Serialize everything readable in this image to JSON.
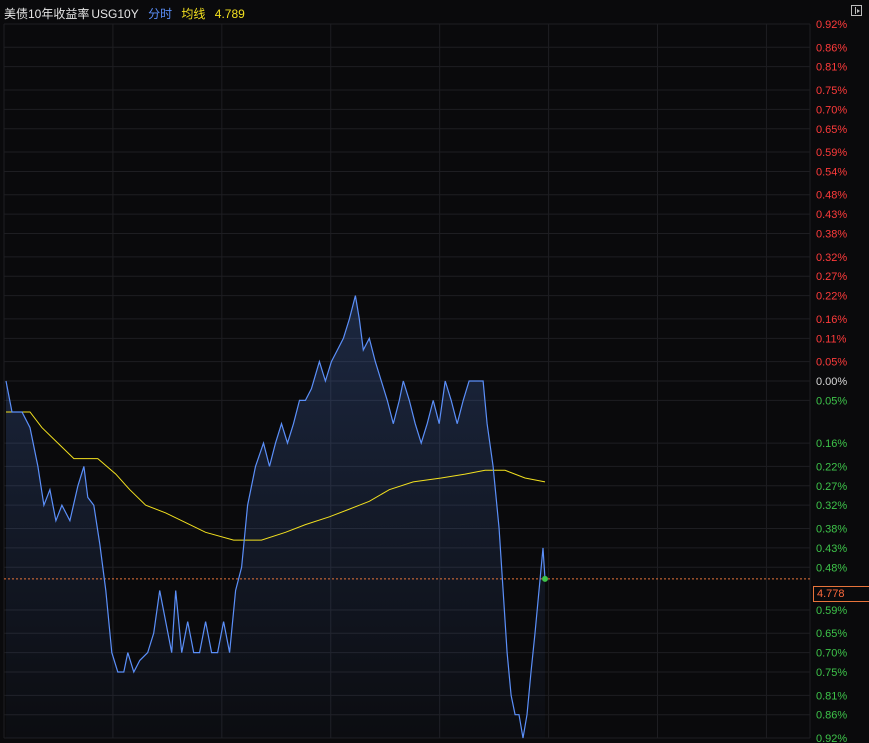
{
  "header": {
    "name": "美债10年收益率",
    "code": "USG10Y",
    "mode_label": "分时",
    "avg_label": "均线",
    "avg_value": "4.789"
  },
  "colors": {
    "background": "#0a0a0c",
    "grid": "#1e1e22",
    "price_line": "#5b8ff9",
    "avg_line": "#f2e01f",
    "up": "#ff3b3b",
    "down": "#3ec44a",
    "zero": "#d8d8d8",
    "reference": "#e8743b"
  },
  "chart_data": {
    "type": "line",
    "title": "",
    "xlabel": "",
    "ylabel": "",
    "grid": true,
    "ylim": [
      -0.92,
      0.92
    ],
    "current_value": "4.778",
    "current_change_pct": -0.51,
    "y_ticks": [
      {
        "label": "0.92%",
        "value": 0.92
      },
      {
        "label": "0.86%",
        "value": 0.86
      },
      {
        "label": "0.81%",
        "value": 0.81
      },
      {
        "label": "0.75%",
        "value": 0.75
      },
      {
        "label": "0.70%",
        "value": 0.7
      },
      {
        "label": "0.65%",
        "value": 0.65
      },
      {
        "label": "0.59%",
        "value": 0.59
      },
      {
        "label": "0.54%",
        "value": 0.54
      },
      {
        "label": "0.48%",
        "value": 0.48
      },
      {
        "label": "0.43%",
        "value": 0.43
      },
      {
        "label": "0.38%",
        "value": 0.38
      },
      {
        "label": "0.32%",
        "value": 0.32
      },
      {
        "label": "0.27%",
        "value": 0.27
      },
      {
        "label": "0.22%",
        "value": 0.22
      },
      {
        "label": "0.16%",
        "value": 0.16
      },
      {
        "label": "0.11%",
        "value": 0.11
      },
      {
        "label": "0.05%",
        "value": 0.05
      },
      {
        "label": "0.00%",
        "value": 0.0
      },
      {
        "label": "0.05%",
        "value": -0.05
      },
      {
        "label": "0.16%",
        "value": -0.16
      },
      {
        "label": "0.22%",
        "value": -0.22
      },
      {
        "label": "0.27%",
        "value": -0.27
      },
      {
        "label": "0.32%",
        "value": -0.32
      },
      {
        "label": "0.38%",
        "value": -0.38
      },
      {
        "label": "0.43%",
        "value": -0.43
      },
      {
        "label": "0.48%",
        "value": -0.48
      },
      {
        "label": "0.59%",
        "value": -0.59
      },
      {
        "label": "0.65%",
        "value": -0.65
      },
      {
        "label": "0.70%",
        "value": -0.7
      },
      {
        "label": "0.75%",
        "value": -0.75
      },
      {
        "label": "0.81%",
        "value": -0.81
      },
      {
        "label": "0.86%",
        "value": -0.86
      },
      {
        "label": "0.92%",
        "value": -0.92
      }
    ],
    "x_max": 270,
    "series": [
      {
        "key": "price",
        "points": [
          [
            0,
            0.0
          ],
          [
            3,
            -0.08
          ],
          [
            8,
            -0.08
          ],
          [
            12,
            -0.12
          ],
          [
            16,
            -0.22
          ],
          [
            19,
            -0.32
          ],
          [
            22,
            -0.28
          ],
          [
            25,
            -0.36
          ],
          [
            28,
            -0.32
          ],
          [
            32,
            -0.36
          ],
          [
            36,
            -0.27
          ],
          [
            39,
            -0.22
          ],
          [
            41,
            -0.3
          ],
          [
            44,
            -0.32
          ],
          [
            47,
            -0.42
          ],
          [
            50,
            -0.54
          ],
          [
            53,
            -0.7
          ],
          [
            56,
            -0.75
          ],
          [
            59,
            -0.75
          ],
          [
            61,
            -0.7
          ],
          [
            64,
            -0.75
          ],
          [
            67,
            -0.72
          ],
          [
            71,
            -0.7
          ],
          [
            74,
            -0.65
          ],
          [
            77,
            -0.54
          ],
          [
            80,
            -0.62
          ],
          [
            83,
            -0.7
          ],
          [
            85,
            -0.54
          ],
          [
            88,
            -0.7
          ],
          [
            91,
            -0.62
          ],
          [
            94,
            -0.7
          ],
          [
            97,
            -0.7
          ],
          [
            100,
            -0.62
          ],
          [
            103,
            -0.7
          ],
          [
            106,
            -0.7
          ],
          [
            109,
            -0.62
          ],
          [
            112,
            -0.7
          ],
          [
            115,
            -0.54
          ],
          [
            118,
            -0.48
          ],
          [
            121,
            -0.32
          ],
          [
            125,
            -0.22
          ],
          [
            129,
            -0.16
          ],
          [
            132,
            -0.22
          ],
          [
            135,
            -0.16
          ],
          [
            138,
            -0.11
          ],
          [
            141,
            -0.16
          ],
          [
            144,
            -0.11
          ],
          [
            147,
            -0.05
          ],
          [
            150,
            -0.05
          ],
          [
            153,
            -0.02
          ],
          [
            157,
            0.05
          ],
          [
            160,
            0.0
          ],
          [
            163,
            0.05
          ],
          [
            166,
            0.08
          ],
          [
            169,
            0.11
          ],
          [
            172,
            0.16
          ],
          [
            175,
            0.22
          ],
          [
            177,
            0.16
          ],
          [
            179,
            0.08
          ],
          [
            182,
            0.11
          ],
          [
            185,
            0.05
          ],
          [
            188,
            0.0
          ],
          [
            191,
            -0.05
          ],
          [
            194,
            -0.11
          ],
          [
            197,
            -0.05
          ],
          [
            199,
            0.0
          ],
          [
            202,
            -0.05
          ],
          [
            205,
            -0.11
          ],
          [
            208,
            -0.16
          ],
          [
            211,
            -0.11
          ],
          [
            214,
            -0.05
          ],
          [
            217,
            -0.11
          ],
          [
            220,
            0.0
          ],
          [
            223,
            -0.05
          ],
          [
            226,
            -0.11
          ],
          [
            229,
            -0.05
          ],
          [
            232,
            0.0
          ],
          [
            236,
            0.0
          ],
          [
            239,
            0.0
          ],
          [
            241,
            -0.11
          ],
          [
            244,
            -0.22
          ],
          [
            247,
            -0.38
          ],
          [
            249,
            -0.54
          ],
          [
            251,
            -0.7
          ],
          [
            253,
            -0.81
          ],
          [
            255,
            -0.86
          ],
          [
            257,
            -0.86
          ],
          [
            259,
            -0.92
          ],
          [
            261,
            -0.86
          ],
          [
            263,
            -0.75
          ],
          [
            265,
            -0.65
          ],
          [
            267,
            -0.54
          ],
          [
            269,
            -0.43
          ],
          [
            270,
            -0.51
          ]
        ]
      },
      {
        "key": "average",
        "points": [
          [
            0,
            -0.08
          ],
          [
            12,
            -0.08
          ],
          [
            18,
            -0.12
          ],
          [
            26,
            -0.16
          ],
          [
            34,
            -0.2
          ],
          [
            46,
            -0.2
          ],
          [
            55,
            -0.24
          ],
          [
            62,
            -0.28
          ],
          [
            70,
            -0.32
          ],
          [
            80,
            -0.34
          ],
          [
            92,
            -0.37
          ],
          [
            100,
            -0.39
          ],
          [
            114,
            -0.41
          ],
          [
            128,
            -0.41
          ],
          [
            140,
            -0.39
          ],
          [
            150,
            -0.37
          ],
          [
            162,
            -0.35
          ],
          [
            172,
            -0.33
          ],
          [
            182,
            -0.31
          ],
          [
            192,
            -0.28
          ],
          [
            204,
            -0.26
          ],
          [
            218,
            -0.25
          ],
          [
            230,
            -0.24
          ],
          [
            240,
            -0.23
          ],
          [
            250,
            -0.23
          ],
          [
            260,
            -0.25
          ],
          [
            270,
            -0.26
          ]
        ]
      }
    ]
  }
}
